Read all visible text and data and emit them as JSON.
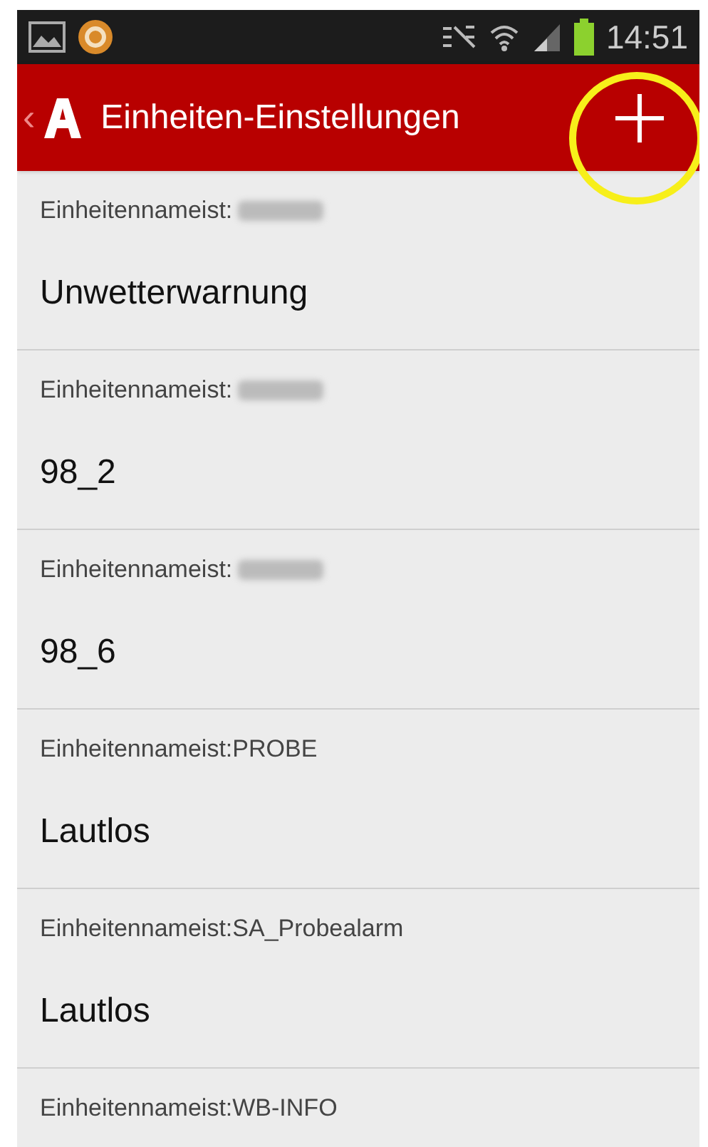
{
  "status_bar": {
    "time": "14:51"
  },
  "action_bar": {
    "back": "‹",
    "title": "Einheiten-Einstellungen"
  },
  "units": [
    {
      "label": "Einheitennameist:",
      "redacted": true,
      "value": "Unwetterwarnung"
    },
    {
      "label": "Einheitennameist:",
      "redacted": true,
      "value": "98_2"
    },
    {
      "label": "Einheitennameist:",
      "redacted": true,
      "value": "98_6"
    },
    {
      "label": "Einheitennameist:PROBE",
      "redacted": false,
      "value": "Lautlos"
    },
    {
      "label": "Einheitennameist:SA_Probealarm",
      "redacted": false,
      "value": "Lautlos"
    },
    {
      "label": "Einheitennameist:WB-INFO",
      "redacted": false
    }
  ]
}
